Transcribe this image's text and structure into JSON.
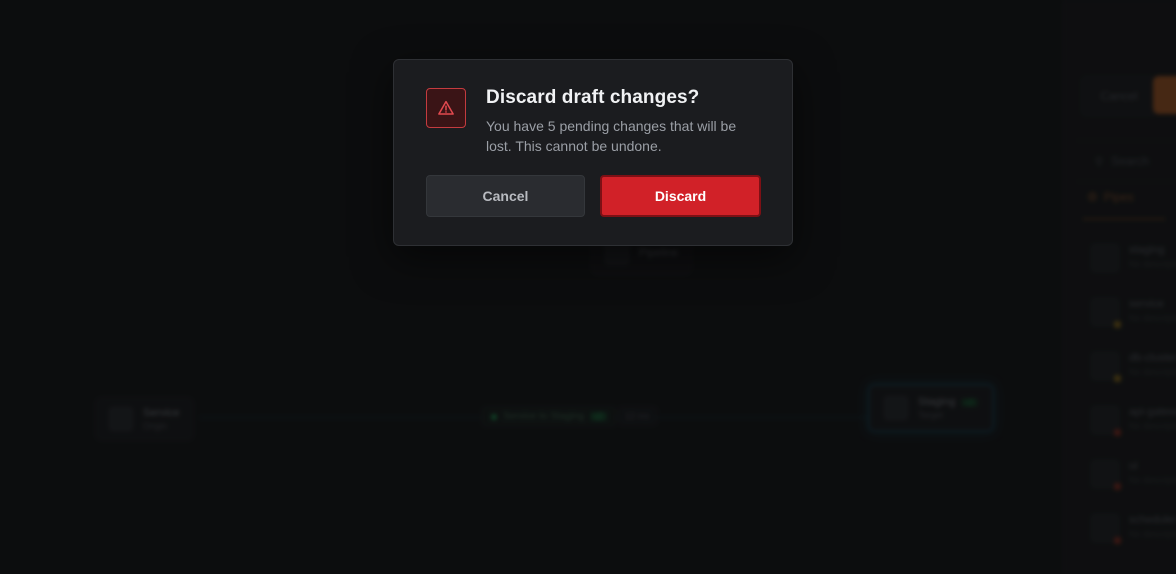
{
  "dialog": {
    "title": "Discard draft changes?",
    "message": "You have 5 pending changes that will be lost. This cannot be undone.",
    "cancel_label": "Cancel",
    "discard_label": "Discard",
    "icon": "warning-triangle-icon",
    "danger_color": "#d12128"
  },
  "background": {
    "source_node": {
      "title": "Service",
      "subtitle": "Origin"
    },
    "target_node": {
      "title": "Staging",
      "subtitle": "Target",
      "tag": "v2"
    },
    "hidden_node": {
      "title": "Pipeline"
    },
    "edge": {
      "label": "Service to Staging",
      "badge": "v2",
      "meta": "12 ms"
    },
    "panel": {
      "cancel_label": "Cancel",
      "search_placeholder": "Search",
      "active_tab": "Pipes",
      "accent_color": "#b05a22",
      "items": [
        {
          "title": "staging",
          "subtitle": "No description",
          "status": ""
        },
        {
          "title": "service",
          "subtitle": "No description",
          "status": "warning"
        },
        {
          "title": "db-cluster",
          "subtitle": "No description",
          "status": "warning"
        },
        {
          "title": "api-gateway",
          "subtitle": "No description",
          "status": "error"
        },
        {
          "title": "ui",
          "subtitle": "No description",
          "status": "error"
        },
        {
          "title": "scheduler",
          "subtitle": "No description",
          "status": "error"
        }
      ]
    }
  }
}
